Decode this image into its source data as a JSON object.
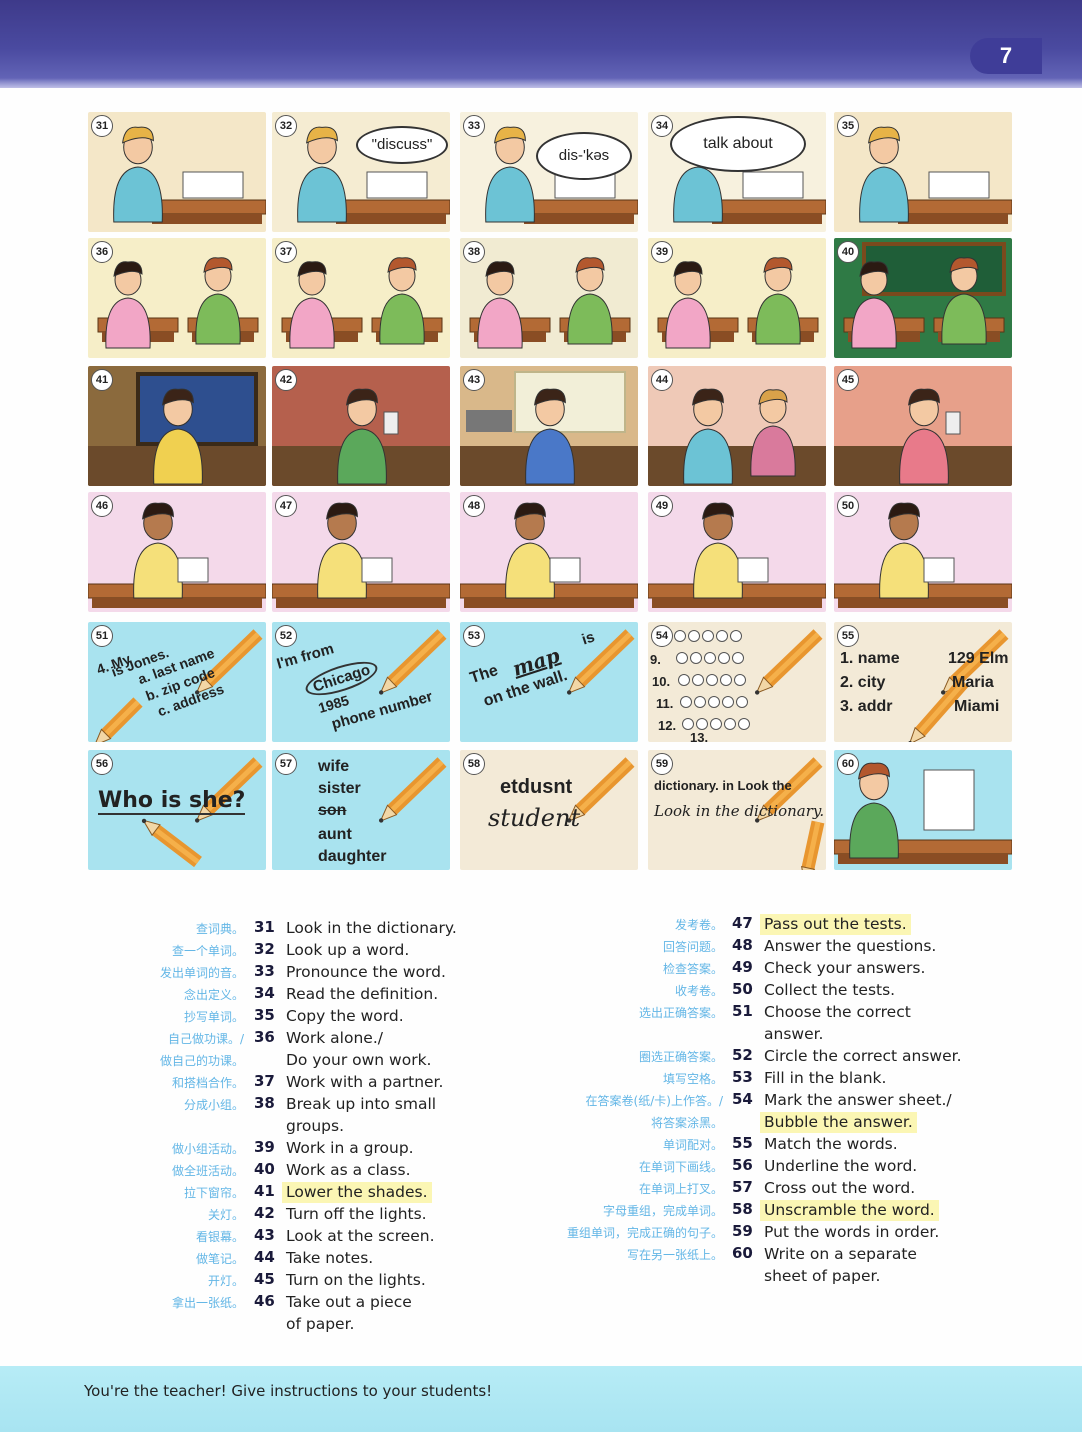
{
  "page_number": "7",
  "cells": [
    {
      "n": "31",
      "text": []
    },
    {
      "n": "32",
      "text": [
        "\"discuss\""
      ]
    },
    {
      "n": "33",
      "text": [
        "dis-'kəs"
      ]
    },
    {
      "n": "34",
      "text": [
        "talk about"
      ]
    },
    {
      "n": "35",
      "text": []
    },
    {
      "n": "36",
      "text": []
    },
    {
      "n": "37",
      "text": []
    },
    {
      "n": "38",
      "text": []
    },
    {
      "n": "39",
      "text": []
    },
    {
      "n": "40",
      "text": []
    },
    {
      "n": "41",
      "text": []
    },
    {
      "n": "42",
      "text": []
    },
    {
      "n": "43",
      "text": []
    },
    {
      "n": "44",
      "text": []
    },
    {
      "n": "45",
      "text": []
    },
    {
      "n": "46",
      "text": []
    },
    {
      "n": "47",
      "text": []
    },
    {
      "n": "48",
      "text": []
    },
    {
      "n": "49",
      "text": []
    },
    {
      "n": "50",
      "text": []
    },
    {
      "n": "51",
      "text": [
        "4. My",
        "is Jones.",
        "a. last name",
        "b. zip code",
        "c. address"
      ]
    },
    {
      "n": "52",
      "text": [
        "I'm from",
        "Chicago",
        "1985",
        "phone number"
      ]
    },
    {
      "n": "53",
      "text": [
        "The",
        "map",
        "is",
        "on the wall."
      ]
    },
    {
      "n": "54",
      "text": [
        "9.",
        "10.",
        "11.",
        "12.",
        "13."
      ]
    },
    {
      "n": "55",
      "text": [
        "1. name",
        "2. city",
        "3. addr",
        "129 Elm",
        "Maria",
        "Miami"
      ]
    },
    {
      "n": "56",
      "text": [
        "Who is she?"
      ]
    },
    {
      "n": "57",
      "text": [
        "wife",
        "sister",
        "son",
        "aunt",
        "daughter"
      ]
    },
    {
      "n": "58",
      "text": [
        "etdusnt",
        "student"
      ]
    },
    {
      "n": "59",
      "text": [
        "dictionary. in Look the",
        "Look in the dictionary."
      ]
    },
    {
      "n": "60",
      "text": []
    }
  ],
  "left_list": [
    {
      "zh": "查词典。",
      "n": "31",
      "en": [
        "Look in the dictionary."
      ],
      "hl": false
    },
    {
      "zh": "查一个单词。",
      "n": "32",
      "en": [
        "Look up a word."
      ],
      "hl": false
    },
    {
      "zh": "发出单词的音。",
      "n": "33",
      "en": [
        "Pronounce the word."
      ],
      "hl": false
    },
    {
      "zh": "念出定义。",
      "n": "34",
      "en": [
        "Read the definition."
      ],
      "hl": false
    },
    {
      "zh": "抄写单词。",
      "n": "35",
      "en": [
        "Copy the word."
      ],
      "hl": false
    },
    {
      "zh": "自己做功课。/",
      "zh2": "做自己的功课。",
      "n": "36",
      "en": [
        "Work alone./",
        "Do your own work."
      ],
      "hl": false
    },
    {
      "zh": "和搭档合作。",
      "n": "37",
      "en": [
        "Work with a partner."
      ],
      "hl": false
    },
    {
      "zh": "分成小组。",
      "n": "38",
      "en": [
        "Break up into small",
        "groups."
      ],
      "hl": false
    },
    {
      "zh": "做小组活动。",
      "n": "39",
      "en": [
        "Work in a group."
      ],
      "hl": false
    },
    {
      "zh": "做全班活动。",
      "n": "40",
      "en": [
        "Work as a class."
      ],
      "hl": false
    },
    {
      "zh": "拉下窗帘。",
      "n": "41",
      "en": [
        "Lower the shades."
      ],
      "hl": true
    },
    {
      "zh": "关灯。",
      "n": "42",
      "en": [
        "Turn off the lights."
      ],
      "hl": false
    },
    {
      "zh": "看银幕。",
      "n": "43",
      "en": [
        "Look at the screen."
      ],
      "hl": false
    },
    {
      "zh": "做笔记。",
      "n": "44",
      "en": [
        "Take notes."
      ],
      "hl": false
    },
    {
      "zh": "开灯。",
      "n": "45",
      "en": [
        "Turn on the lights."
      ],
      "hl": false
    },
    {
      "zh": "拿出一张纸。",
      "n": "46",
      "en": [
        "Take out a piece",
        "of paper."
      ],
      "hl": false
    }
  ],
  "right_list": [
    {
      "zh": "发考卷。",
      "n": "47",
      "en": [
        "Pass out the tests."
      ],
      "hl": true
    },
    {
      "zh": "回答问题。",
      "n": "48",
      "en": [
        "Answer the questions."
      ],
      "hl": false
    },
    {
      "zh": "检查答案。",
      "n": "49",
      "en": [
        "Check your answers."
      ],
      "hl": false
    },
    {
      "zh": "收考卷。",
      "n": "50",
      "en": [
        "Collect the tests."
      ],
      "hl": false
    },
    {
      "zh": "选出正确答案。",
      "n": "51",
      "en": [
        "Choose the correct",
        "answer."
      ],
      "hl": false
    },
    {
      "zh": "圈选正确答案。",
      "n": "52",
      "en": [
        "Circle the correct answer."
      ],
      "hl": false
    },
    {
      "zh": "填写空格。",
      "n": "53",
      "en": [
        "Fill in the blank."
      ],
      "hl": false
    },
    {
      "zh": "在答案卷(纸/卡)上作答。/",
      "zh2": "将答案涂黑。",
      "n": "54",
      "en": [
        "Mark the answer sheet./",
        "Bubble the answer."
      ],
      "hl": "second"
    },
    {
      "zh": "单词配对。",
      "n": "55",
      "en": [
        "Match the words."
      ],
      "hl": false
    },
    {
      "zh": "在单词下画线。",
      "n": "56",
      "en": [
        "Underline the word."
      ],
      "hl": false
    },
    {
      "zh": "在单词上打叉。",
      "n": "57",
      "en": [
        "Cross out the word."
      ],
      "hl": false
    },
    {
      "zh": "字母重组，完成单词。",
      "n": "58",
      "en": [
        "Unscramble the word."
      ],
      "hl": true
    },
    {
      "zh": "重组单词，完成正确的句子。",
      "n": "59",
      "en": [
        "Put the words in order."
      ],
      "hl": false
    },
    {
      "zh": "写在另一张纸上。",
      "n": "60",
      "en": [
        "Write on a separate",
        "sheet of paper."
      ],
      "hl": false
    }
  ],
  "footer": "You're the teacher!  Give instructions to your students!"
}
